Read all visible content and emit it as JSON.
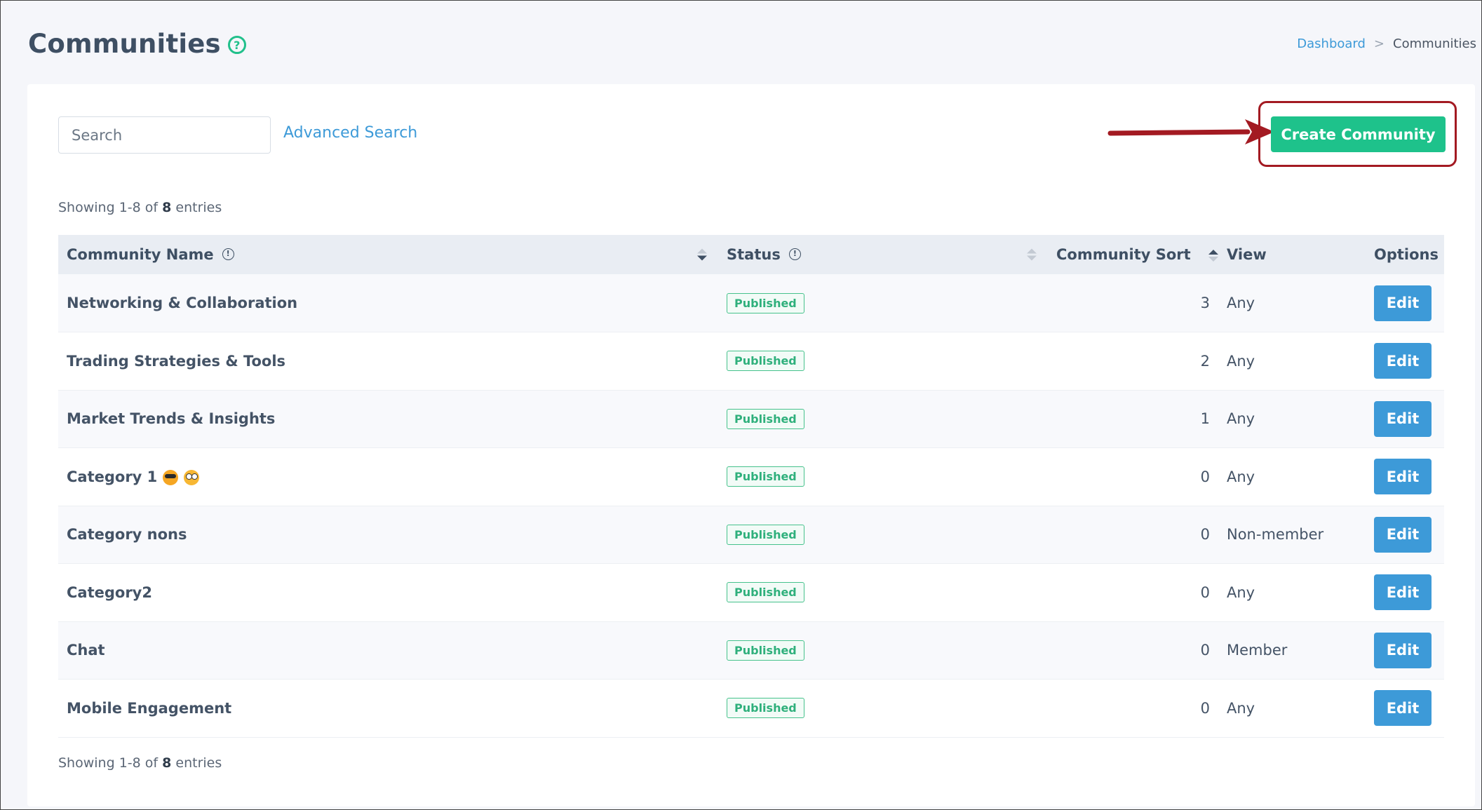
{
  "header": {
    "title": "Communities",
    "breadcrumb": {
      "home": "Dashboard",
      "separator": ">",
      "current": "Communities"
    }
  },
  "toolbar": {
    "search_placeholder": "Search",
    "advanced_search": "Advanced Search",
    "create_button": "Create Community"
  },
  "pagination": {
    "prefix": "Showing ",
    "range": "1-8",
    "of": " of ",
    "total": "8",
    "suffix": " entries"
  },
  "table": {
    "columns": [
      "Community Name",
      "Status",
      "Community Sort",
      "View",
      "Options"
    ],
    "rows": [
      {
        "name": "Networking & Collaboration",
        "status": "Published",
        "sort": "3",
        "view": "Any",
        "action": "Edit"
      },
      {
        "name": "Trading Strategies & Tools",
        "status": "Published",
        "sort": "2",
        "view": "Any",
        "action": "Edit"
      },
      {
        "name": "Market Trends & Insights",
        "status": "Published",
        "sort": "1",
        "view": "Any",
        "action": "Edit"
      },
      {
        "name": "Category 1",
        "emojis": [
          "sunglasses-emoji",
          "silly-face-emoji"
        ],
        "status": "Published",
        "sort": "0",
        "view": "Any",
        "action": "Edit"
      },
      {
        "name": "Category nons",
        "status": "Published",
        "sort": "0",
        "view": "Non-member",
        "action": "Edit"
      },
      {
        "name": "Category2",
        "status": "Published",
        "sort": "0",
        "view": "Any",
        "action": "Edit"
      },
      {
        "name": "Chat",
        "status": "Published",
        "sort": "0",
        "view": "Member",
        "action": "Edit"
      },
      {
        "name": "Mobile Engagement",
        "status": "Published",
        "sort": "0",
        "view": "Any",
        "action": "Edit"
      }
    ]
  },
  "colors": {
    "accent_green": "#1ec28b",
    "link_blue": "#3d9ad8",
    "highlight_red": "#a31a22"
  }
}
